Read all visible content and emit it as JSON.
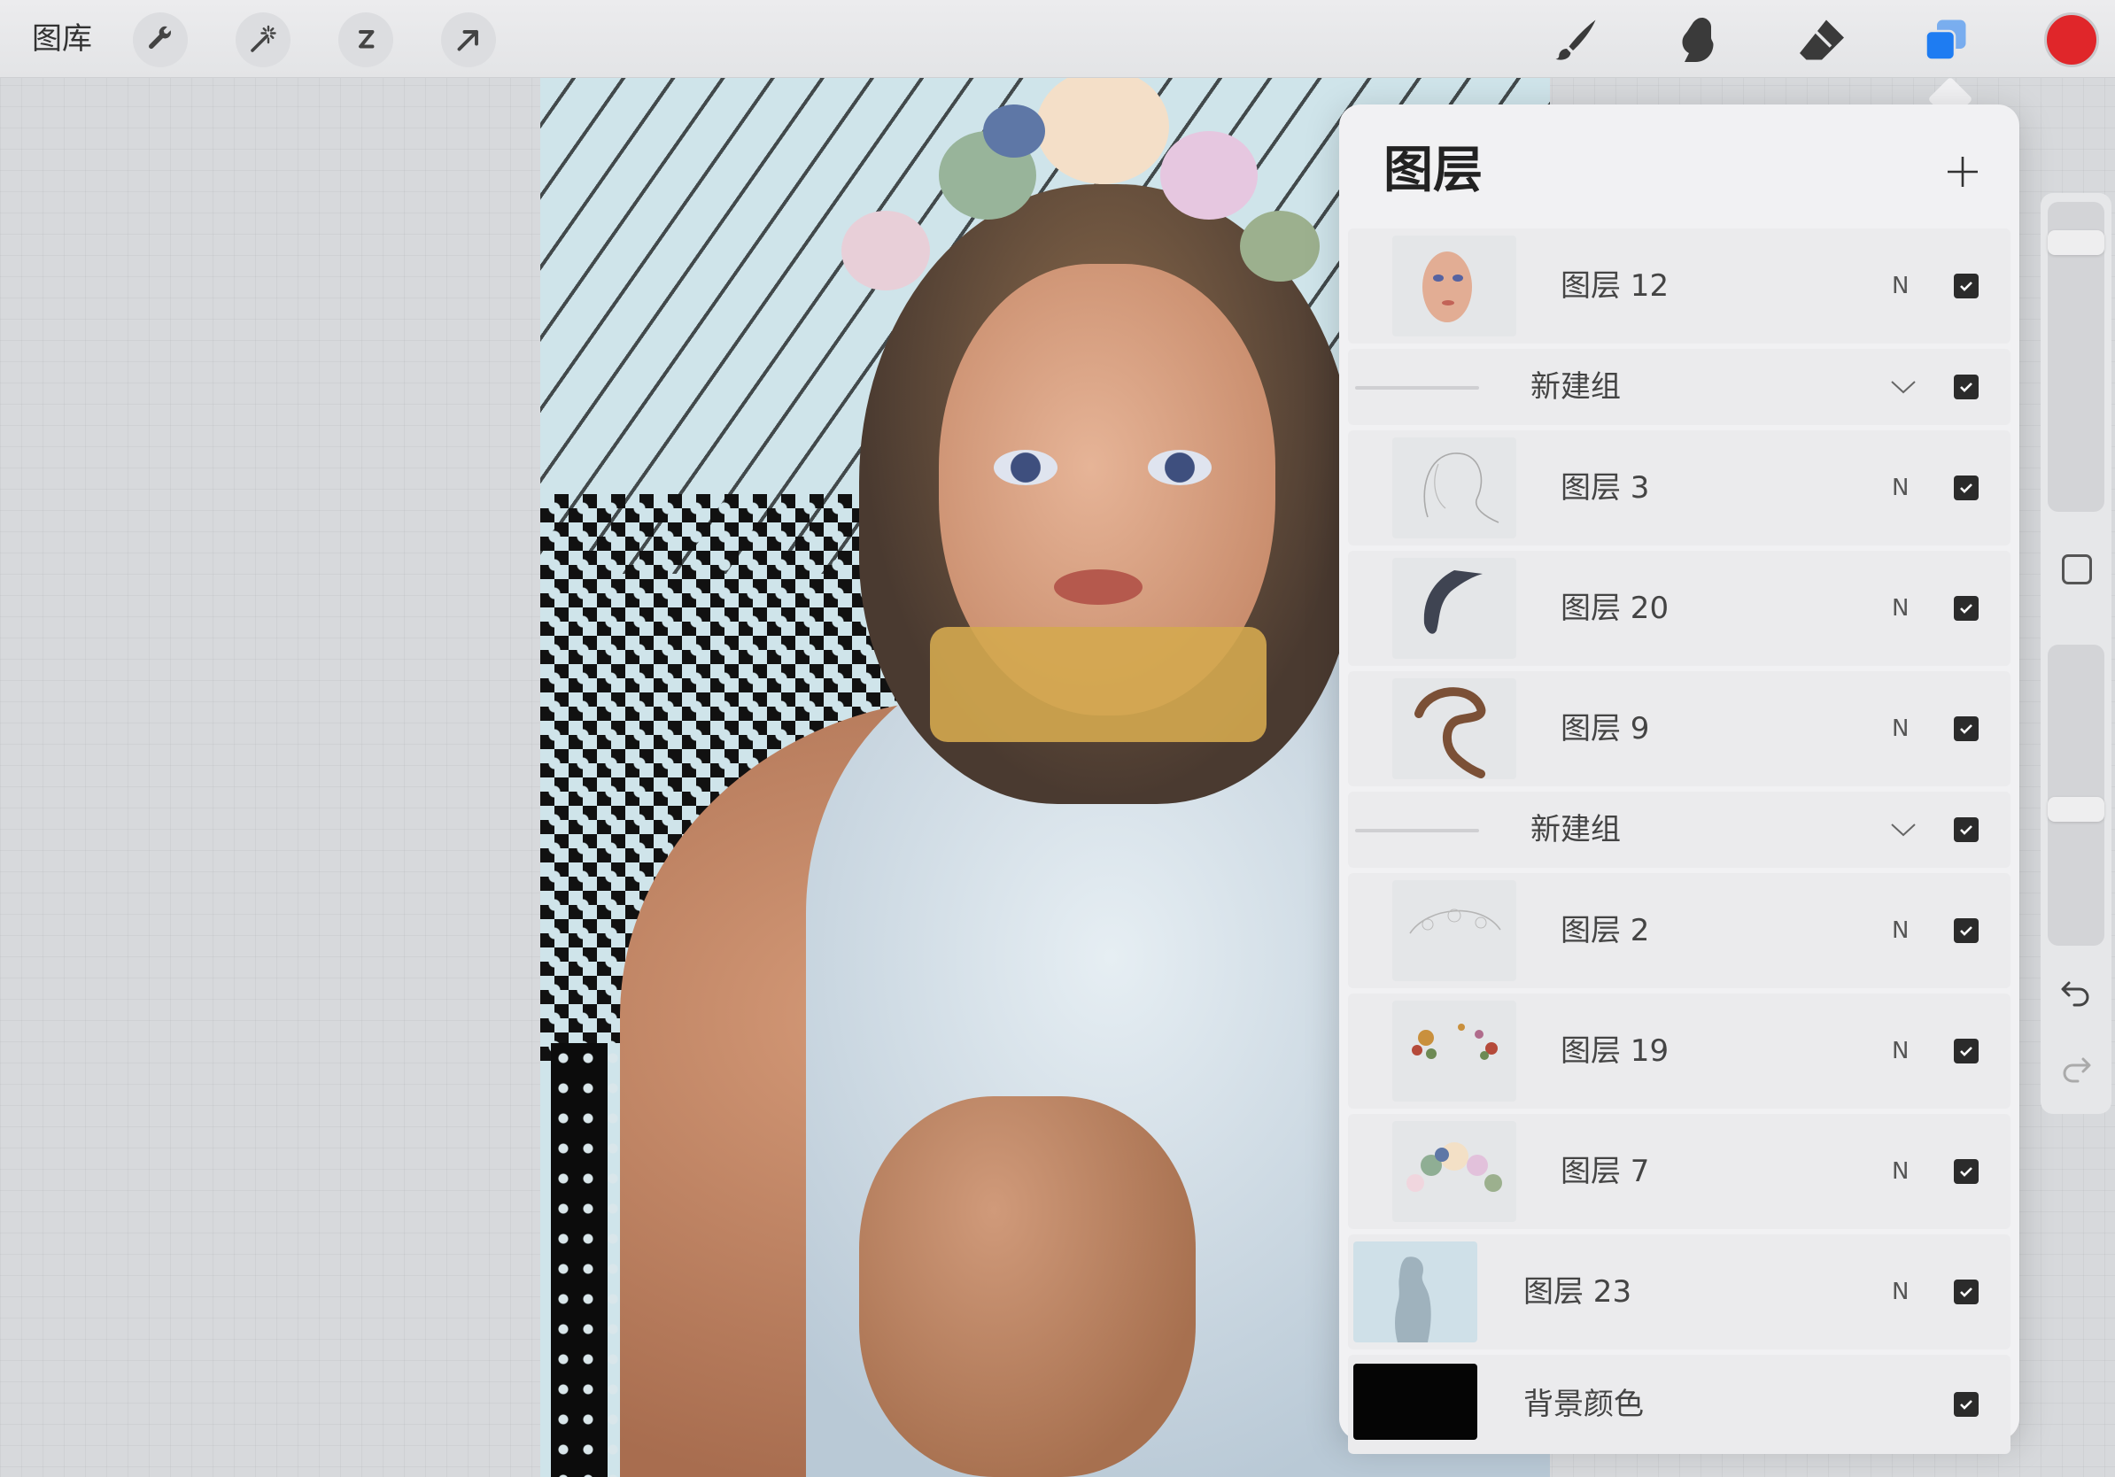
{
  "toolbar": {
    "gallery_label": "图库",
    "left_tools": [
      {
        "name": "actions",
        "icon": "wrench-icon"
      },
      {
        "name": "adjustments",
        "icon": "magic-wand-icon"
      },
      {
        "name": "selection",
        "icon": "selection-s-icon"
      },
      {
        "name": "transform",
        "icon": "arrow-cursor-icon"
      }
    ],
    "right_tools": [
      {
        "name": "brush",
        "icon": "brush-icon"
      },
      {
        "name": "smudge",
        "icon": "smudge-icon"
      },
      {
        "name": "eraser",
        "icon": "eraser-icon"
      },
      {
        "name": "layers",
        "icon": "layers-icon",
        "active": true
      }
    ],
    "current_color": "#e0262a",
    "accent_color": "#1e7cf2"
  },
  "layers_panel": {
    "title": "图层",
    "add_icon": "plus-icon",
    "layers": [
      {
        "type": "layer",
        "name": "图层 12",
        "blend": "N",
        "visible": true
      },
      {
        "type": "group",
        "name": "新建组",
        "visible": true
      },
      {
        "type": "layer",
        "name": "图层 3",
        "blend": "N",
        "visible": true
      },
      {
        "type": "layer",
        "name": "图层 20",
        "blend": "N",
        "visible": true
      },
      {
        "type": "layer",
        "name": "图层 9",
        "blend": "N",
        "visible": true
      },
      {
        "type": "group",
        "name": "新建组",
        "visible": true
      },
      {
        "type": "layer",
        "name": "图层 2",
        "blend": "N",
        "visible": true
      },
      {
        "type": "layer",
        "name": "图层 19",
        "blend": "N",
        "visible": true
      },
      {
        "type": "layer",
        "name": "图层 7",
        "blend": "N",
        "visible": true
      },
      {
        "type": "layer",
        "name": "图层 23",
        "blend": "N",
        "visible": true
      },
      {
        "type": "background",
        "name": "背景颜色",
        "visible": true,
        "color": "#050505"
      }
    ]
  },
  "sidebar": {
    "size_slider": 0.1,
    "opacity_slider": 0.55,
    "modify_icon": "square-icon",
    "undo_icon": "undo-icon",
    "redo_icon": "redo-icon"
  }
}
